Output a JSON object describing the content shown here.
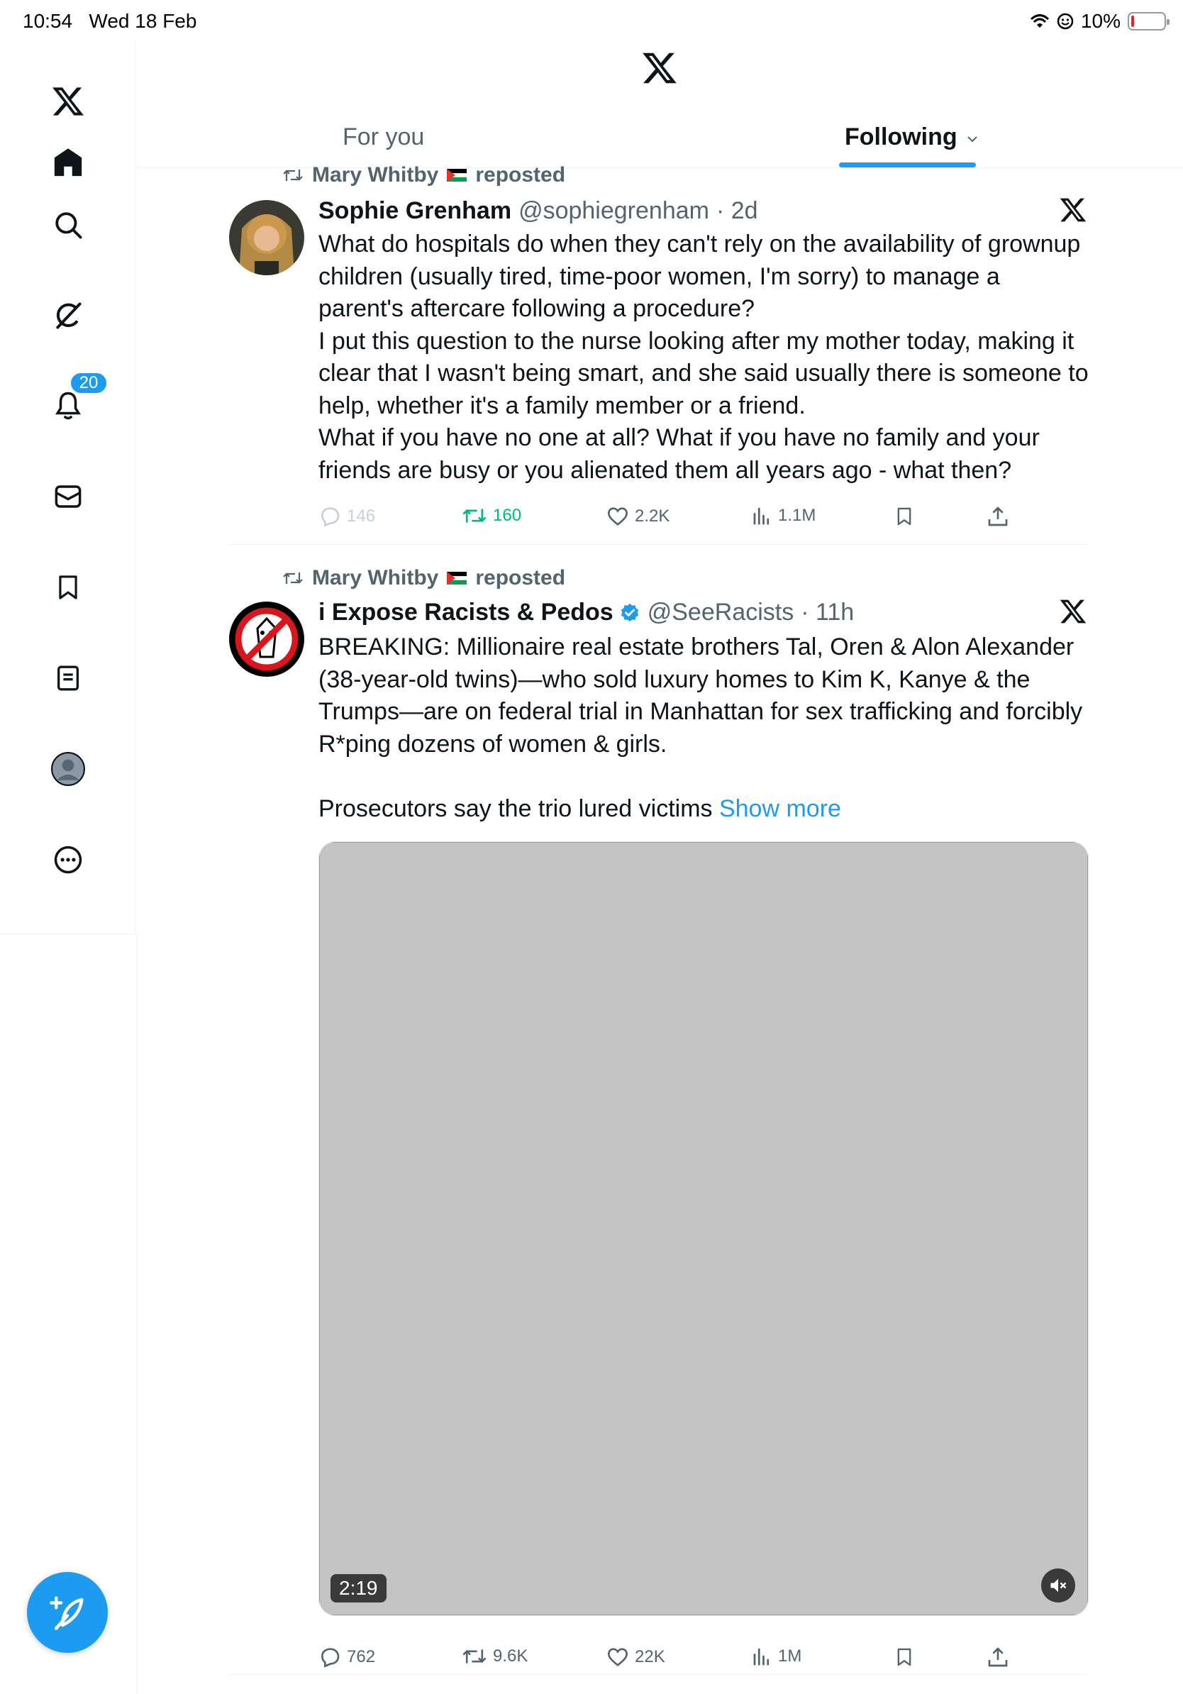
{
  "status_bar": {
    "time": "10:54",
    "date": "Wed 18 Feb",
    "battery": "10%",
    "battery_level": 0.1
  },
  "sidebar": {
    "items": [
      {
        "icon": "x-logo-icon"
      },
      {
        "icon": "home-icon"
      },
      {
        "icon": "search-icon"
      },
      {
        "icon": "grok-icon"
      },
      {
        "icon": "notifications-icon",
        "badge": "20"
      },
      {
        "icon": "messages-icon"
      },
      {
        "icon": "bookmarks-icon"
      },
      {
        "icon": "lists-icon"
      },
      {
        "icon": "profile-icon"
      },
      {
        "icon": "more-icon"
      }
    ],
    "compose_icon": "compose-icon"
  },
  "header": {
    "logo": "x-logo-icon"
  },
  "tabs": [
    {
      "label": "For you",
      "active": false
    },
    {
      "label": "Following",
      "active": true
    }
  ],
  "colors": {
    "accent": "#1d9bf0",
    "retweet": "#00ba7c",
    "secondary_text": "#536471"
  },
  "tweets": [
    {
      "reposter": "Mary Whitby",
      "repost_label": "reposted",
      "display_name": "Sophie Grenham",
      "handle": "@sophiegrenham",
      "time": "· 2d",
      "text": "What do hospitals do when they can't rely on the availability of grownup children (usually tired, time-poor women, I'm sorry) to manage a parent's aftercare following a procedure?\nI put this question to the nurse looking after my mother today, making it clear that I wasn't being smart, and she said usually there is someone to help, whether it's a family member or a friend.\nWhat if you have no one at all? What if you have no family and your friends are busy or you alienated them all years ago - what then?",
      "stats": {
        "replies": "146",
        "reposts": "160",
        "likes": "2.2K",
        "views": "1.1M"
      }
    },
    {
      "reposter": "Mary Whitby",
      "repost_label": "reposted",
      "display_name": "i Expose Racists & Pedos",
      "handle": "@SeeRacists",
      "time": "· 11h",
      "text": "BREAKING: Millionaire real estate brothers Tal, Oren & Alon Alexander (38-year-old twins)—who sold luxury homes to Kim K, Kanye & the Trumps—are on federal trial in Manhattan for sex trafficking and forcibly R*ping dozens of women & girls.\n\nProsecutors say the trio lured victims ",
      "show_more": "Show more",
      "media": {
        "duration": "2:19",
        "muted_icon": "speaker-muted-icon"
      },
      "stats": {
        "replies": "762",
        "reposts": "9.6K",
        "likes": "22K",
        "views": "1M"
      }
    }
  ]
}
